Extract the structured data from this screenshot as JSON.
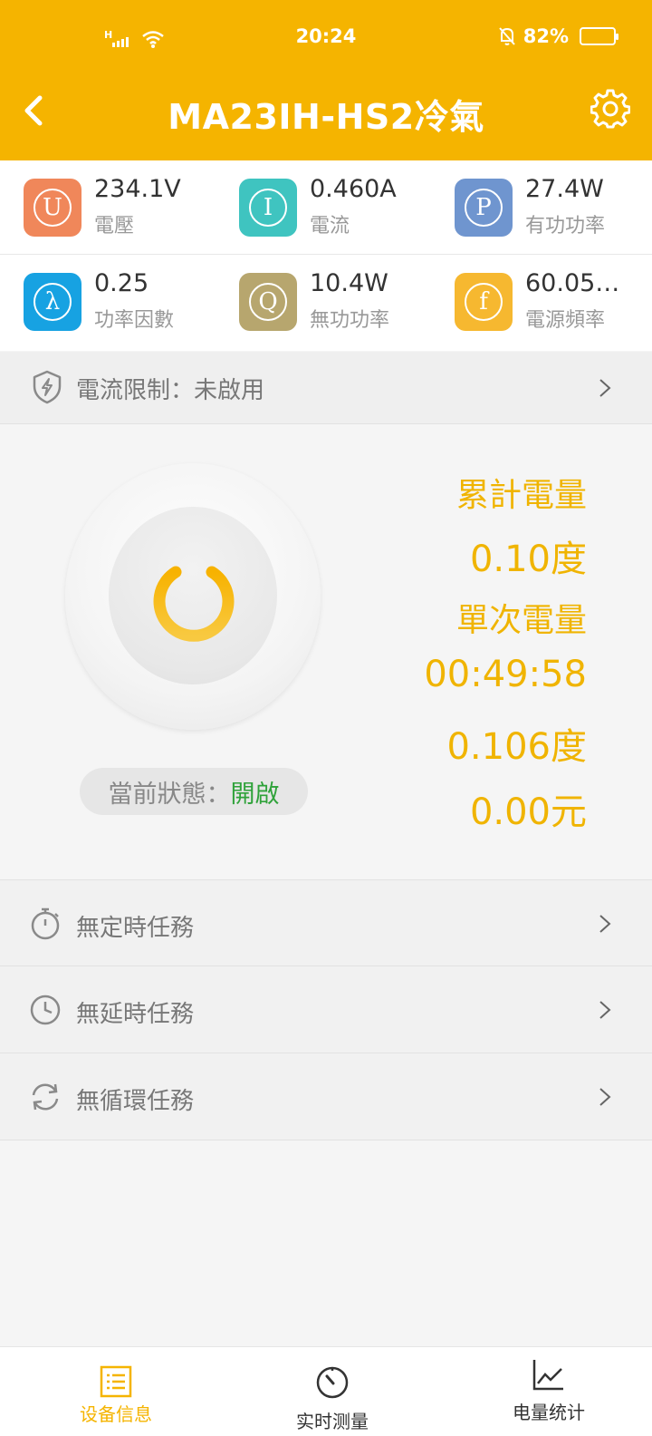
{
  "status_bar": {
    "network": "H",
    "time": "20:24",
    "battery": "82%"
  },
  "nav": {
    "title": "MA23IH-HS2冷氣"
  },
  "metrics": [
    {
      "symbol": "U",
      "value": "234.1V",
      "label": "電壓",
      "color": "#f0875a"
    },
    {
      "symbol": "I",
      "value": "0.460A",
      "label": "電流",
      "color": "#3fc4c0"
    },
    {
      "symbol": "P",
      "value": "27.4W",
      "label": "有功功率",
      "color": "#6f95cf"
    },
    {
      "symbol": "λ",
      "value": "0.25",
      "label": "功率因數",
      "color": "#17a2e2"
    },
    {
      "symbol": "Q",
      "value": "10.4W",
      "label": "無功功率",
      "color": "#b7a66e"
    },
    {
      "symbol": "f",
      "value": "60.05…",
      "label": "電源頻率",
      "color": "#f6b830"
    }
  ],
  "current_limit": {
    "label": "電流限制：",
    "value": "未啟用"
  },
  "power": {
    "state_label": "當前狀態：",
    "state_value": "開啟"
  },
  "energy": {
    "total_label": "累計電量",
    "total_value": "0.10度",
    "single_label": "單次電量",
    "duration": "00:49:58",
    "single_value": "0.106度",
    "cost": "0.00元"
  },
  "tasks": [
    {
      "icon": "stopwatch-icon",
      "label": "無定時任務"
    },
    {
      "icon": "clock-icon",
      "label": "無延時任務"
    },
    {
      "icon": "repeat-icon",
      "label": "無循環任務"
    }
  ],
  "tabbar": [
    {
      "label": "设备信息",
      "icon": "list-icon",
      "active": true
    },
    {
      "label": "实时测量",
      "icon": "gauge-icon",
      "active": false
    },
    {
      "label": "电量统计",
      "icon": "line-chart-icon",
      "active": false
    }
  ],
  "colors": {
    "accent": "#f5b400",
    "energy_text": "#f0b400",
    "state_on": "#2fa23a"
  }
}
